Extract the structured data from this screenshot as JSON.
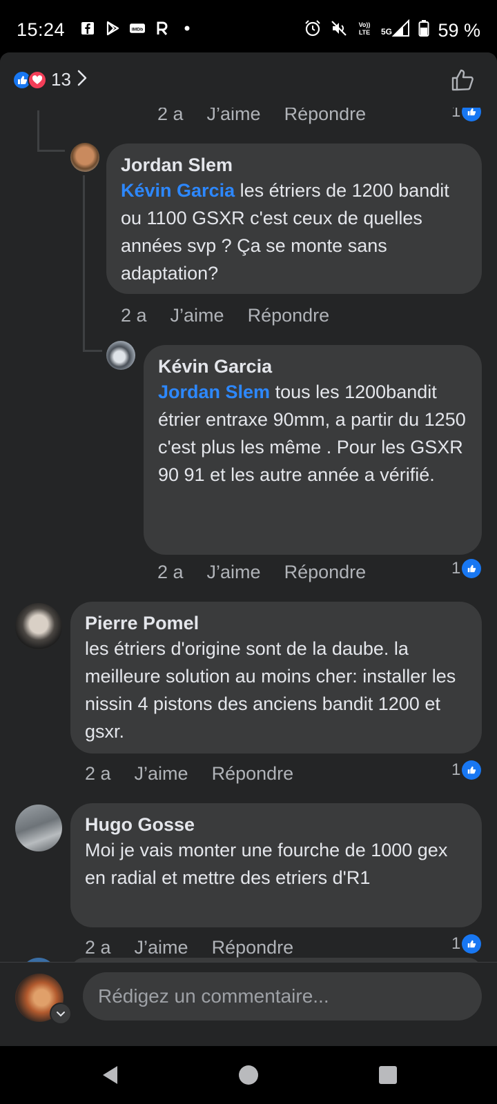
{
  "status_bar": {
    "time": "15:24",
    "battery": "59 %",
    "left_icons": [
      "facebook-icon",
      "play-store-icon",
      "imdb-icon",
      "r-app-icon",
      "dot-icon"
    ],
    "right_icons": [
      "alarm-icon",
      "mute-icon",
      "volte-icon",
      "signal-5g-icon",
      "battery-icon"
    ]
  },
  "header": {
    "reaction_count": "13"
  },
  "comments": [
    {
      "id": "partial",
      "time": "2 a",
      "like": "J’aime",
      "reply": "Répondre",
      "likes": "1"
    },
    {
      "id": "jordan",
      "author": "Jordan Slem",
      "mention": "Kévin Garcia",
      "text": " les étriers de 1200 bandit ou 1100 GSXR c'est ceux de quelles années svp ? Ça se monte sans adaptation?",
      "time": "2 a",
      "like": "J’aime",
      "reply": "Répondre"
    },
    {
      "id": "kevin",
      "author": "Kévin Garcia",
      "mention": "Jordan Slem",
      "text": " tous les 1200bandit étrier entraxe 90mm, a partir du 1250 c'est plus les même . Pour les GSXR 90 91 et les autre année a vérifié.",
      "time": "2 a",
      "like": "J’aime",
      "reply": "Répondre",
      "likes": "1"
    },
    {
      "id": "pierre",
      "author": "Pierre Pomel",
      "text": "les étriers d'origine sont de la daube. la meilleure solution au moins cher: installer les nissin 4 pistons des anciens bandit 1200 et gsxr.",
      "time": "2 a",
      "like": "J’aime",
      "reply": "Répondre",
      "likes": "1"
    },
    {
      "id": "hugo",
      "author": "Hugo Gosse",
      "text": "Moi je vais monter une fourche de 1000 gex en radial et mettre des etriers d'R1",
      "time": "2 a",
      "like": "J’aime",
      "reply": "Répondre",
      "likes": "1"
    }
  ],
  "composer": {
    "placeholder": "Rédigez un commentaire..."
  },
  "colors": {
    "background": "#242526",
    "bubble": "#3a3b3c",
    "mention": "#2d88ff",
    "like_blue": "#1877f2",
    "love_red": "#f33e58"
  }
}
